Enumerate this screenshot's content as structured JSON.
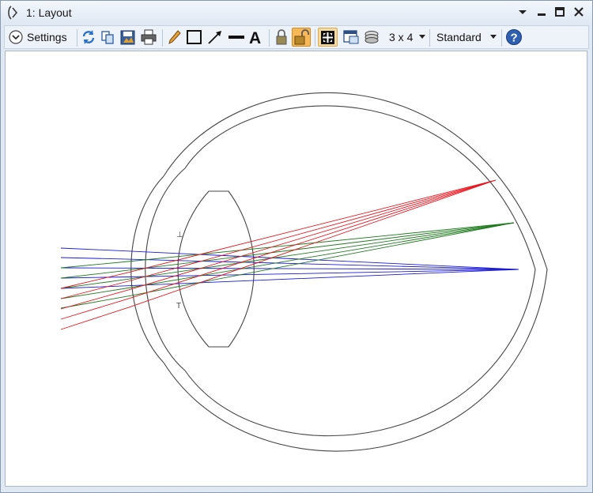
{
  "window": {
    "title": "1: Layout"
  },
  "toolbar": {
    "settings_label": "Settings",
    "grid_label": "3 x 4",
    "mode_label": "Standard"
  },
  "icons": [
    "expand-circle-icon",
    "refresh-icon",
    "copy-icon",
    "save-icon",
    "print-icon",
    "pencil-icon",
    "rectangle-icon",
    "arrow-line-icon",
    "line-icon",
    "text-icon",
    "lock-icon",
    "unlock-icon",
    "fit-icon",
    "window-icon",
    "layers-icon",
    "help-icon"
  ],
  "diagram": {
    "ray_colors": {
      "red": "#e8141e",
      "green": "#1e7a1e",
      "blue": "#1a1ad6"
    },
    "lens_marker_top": "⊥",
    "lens_marker_bottom": "T"
  }
}
